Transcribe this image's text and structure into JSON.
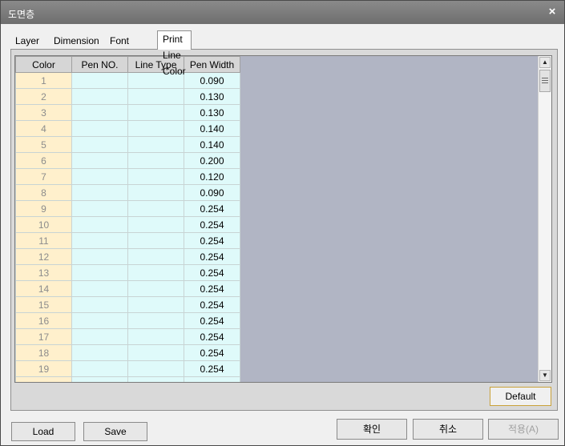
{
  "window": {
    "title": "도면층"
  },
  "tabs": [
    {
      "label": "Layer"
    },
    {
      "label": "Dimension"
    },
    {
      "label": "Font Style"
    },
    {
      "label": "Print Line Color"
    }
  ],
  "table": {
    "headers": [
      "Color",
      "Pen NO.",
      "Line Type",
      "Pen Width"
    ],
    "rows": [
      {
        "color": "1",
        "pen": "",
        "type": "",
        "width": "0.090"
      },
      {
        "color": "2",
        "pen": "",
        "type": "",
        "width": "0.130"
      },
      {
        "color": "3",
        "pen": "",
        "type": "",
        "width": "0.130"
      },
      {
        "color": "4",
        "pen": "",
        "type": "",
        "width": "0.140"
      },
      {
        "color": "5",
        "pen": "",
        "type": "",
        "width": "0.140"
      },
      {
        "color": "6",
        "pen": "",
        "type": "",
        "width": "0.200"
      },
      {
        "color": "7",
        "pen": "",
        "type": "",
        "width": "0.120"
      },
      {
        "color": "8",
        "pen": "",
        "type": "",
        "width": "0.090"
      },
      {
        "color": "9",
        "pen": "",
        "type": "",
        "width": "0.254"
      },
      {
        "color": "10",
        "pen": "",
        "type": "",
        "width": "0.254"
      },
      {
        "color": "11",
        "pen": "",
        "type": "",
        "width": "0.254"
      },
      {
        "color": "12",
        "pen": "",
        "type": "",
        "width": "0.254"
      },
      {
        "color": "13",
        "pen": "",
        "type": "",
        "width": "0.254"
      },
      {
        "color": "14",
        "pen": "",
        "type": "",
        "width": "0.254"
      },
      {
        "color": "15",
        "pen": "",
        "type": "",
        "width": "0.254"
      },
      {
        "color": "16",
        "pen": "",
        "type": "",
        "width": "0.254"
      },
      {
        "color": "17",
        "pen": "",
        "type": "",
        "width": "0.254"
      },
      {
        "color": "18",
        "pen": "",
        "type": "",
        "width": "0.254"
      },
      {
        "color": "19",
        "pen": "",
        "type": "",
        "width": "0.254"
      },
      {
        "color": "",
        "pen": "",
        "type": "",
        "width": ""
      }
    ]
  },
  "buttons": {
    "default": "Default",
    "load": "Load",
    "save": "Save",
    "ok": "확인",
    "cancel": "취소",
    "apply": "적용(A)"
  },
  "icons": {
    "close": "×",
    "scroll_up": "▲",
    "scroll_down": "▼"
  },
  "colors": {
    "color_column": "#fff0cc",
    "value_columns": "#dffafa",
    "grid_background": "#b1b5c4",
    "default_button_border": "#c9a23a"
  }
}
